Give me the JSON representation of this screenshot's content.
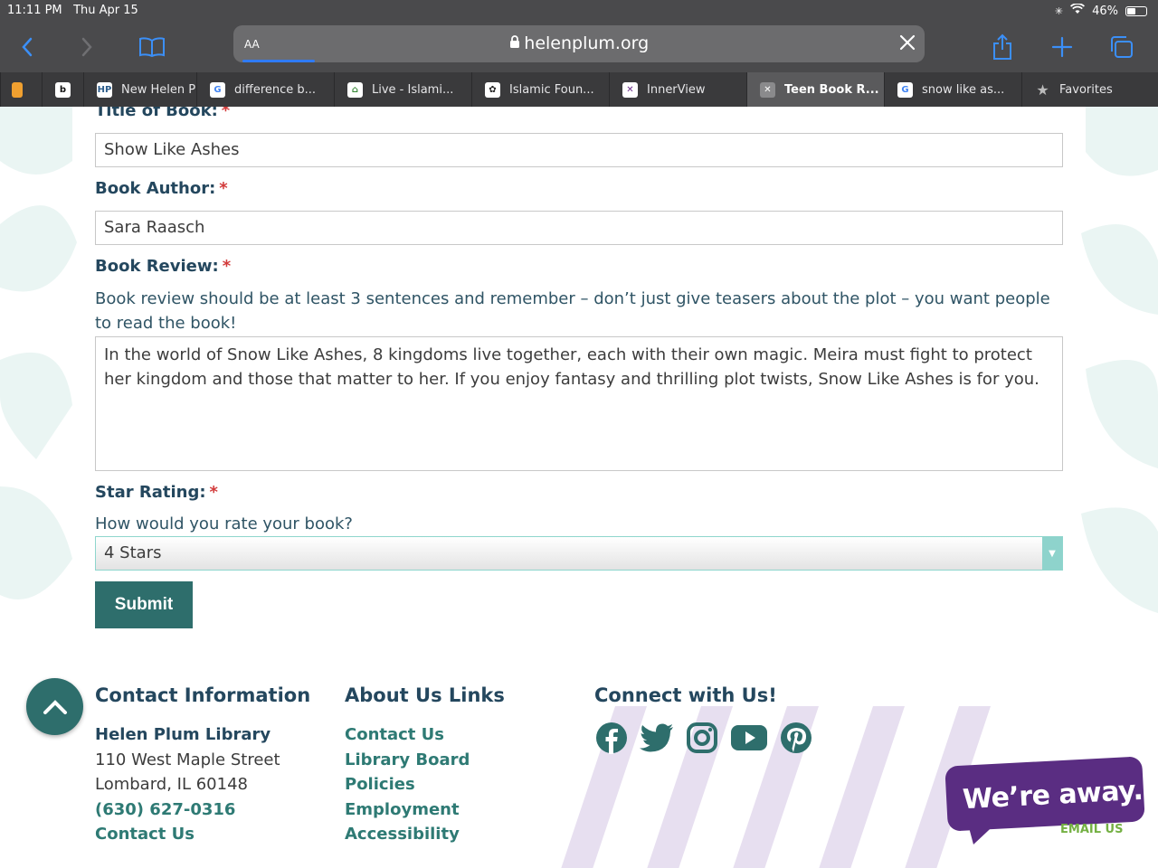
{
  "status": {
    "time": "11:11 PM",
    "date": "Thu Apr 15",
    "battery": "46%"
  },
  "browser": {
    "aa": "AA",
    "url": "helenplum.org",
    "tabs": [
      {
        "label": "New Helen P",
        "fav_bg": "#ffffff",
        "fav_fg": "#2a5b8a",
        "fav": "HP"
      },
      {
        "label": "difference b...",
        "fav_bg": "#ffffff",
        "fav_fg": "#4285f4",
        "fav": "G"
      },
      {
        "label": "Live - Islami...",
        "fav_bg": "#ffffff",
        "fav_fg": "#3a8a3a",
        "fav": "⌂"
      },
      {
        "label": "Islamic Foun...",
        "fav_bg": "#ffffff",
        "fav_fg": "#222222",
        "fav": "✿"
      },
      {
        "label": "InnerView",
        "fav_bg": "#ffffff",
        "fav_fg": "#6a2b8a",
        "fav": "✕"
      },
      {
        "label": "Teen Book R...",
        "fav_bg": "#8a8a8c",
        "fav_fg": "#ffffff",
        "fav": "✕",
        "active": true
      },
      {
        "label": "snow like as...",
        "fav_bg": "#ffffff",
        "fav_fg": "#4285f4",
        "fav": "G"
      },
      {
        "label": "Favorites",
        "fav_bg": "transparent",
        "fav_fg": "#bbbbbb",
        "fav": "★"
      }
    ]
  },
  "form": {
    "title_label": "Title of Book:",
    "title_value": "Show Like Ashes",
    "author_label": "Book Author:",
    "author_value": "Sara Raasch",
    "review_label": "Book Review:",
    "review_help": "Book review should be at least 3 sentences and remember – don’t just give teasers about the plot – you want people to read the book!",
    "review_value": "In the world of Snow Like Ashes, 8 kingdoms live together, each with their own magic. Meira must fight to protect her kingdom and those that matter to her. If you enjoy fantasy and thrilling plot twists, Snow Like Ashes is for you.",
    "rating_label": "Star Rating:",
    "rating_help": "How would you rate your book?",
    "rating_value": "4 Stars",
    "required_mark": "*",
    "submit_label": "Submit"
  },
  "footer": {
    "contact": {
      "heading": "Contact Information",
      "name": "Helen Plum Library",
      "street": "110 West Maple Street",
      "city": "Lombard, IL 60148",
      "phone": "(630) 627-0316",
      "contact_link": "Contact Us"
    },
    "about": {
      "heading": "About Us Links",
      "links": [
        "Contact Us",
        "Library Board",
        "Policies",
        "Employment",
        "Accessibility"
      ]
    },
    "connect": {
      "heading": "Connect with Us!",
      "icons": [
        "facebook-icon",
        "twitter-icon",
        "instagram-icon",
        "youtube-icon",
        "pinterest-icon"
      ]
    }
  },
  "chat": {
    "text": "We’re away.",
    "email": "EMAIL US"
  },
  "colors": {
    "heading": "#24475e",
    "accent": "#2e6e6c",
    "link": "#2e7a74",
    "required": "#d23a3a",
    "chat": "#5a2d82"
  }
}
